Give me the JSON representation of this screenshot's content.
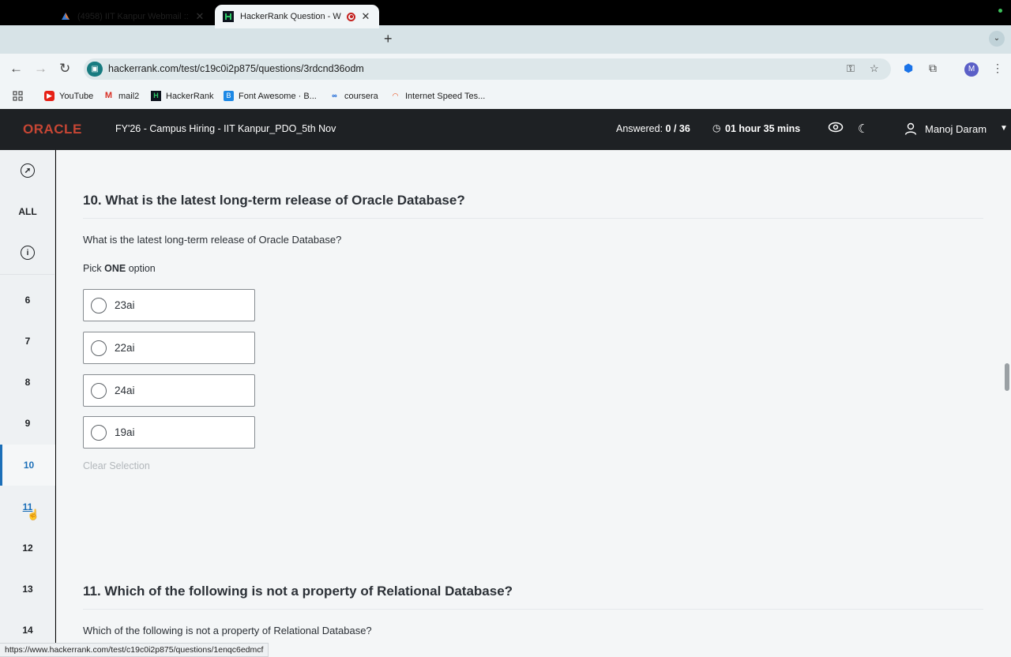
{
  "browser": {
    "tabs": [
      {
        "title": "(4958) IIT Kanpur Webmail ::",
        "favicon": "webmail-logo-icon",
        "active": false
      },
      {
        "title": "HackerRank Question - W",
        "favicon": "hackerrank-logo-icon",
        "active": true
      }
    ],
    "url": "hackerrank.com/test/c19c0i2p875/questions/3rdcnd36odm",
    "bookmarks": [
      {
        "label": "YouTube",
        "icon": "youtube-icon"
      },
      {
        "label": "mail2",
        "icon": "gmail-icon"
      },
      {
        "label": "HackerRank",
        "icon": "hackerrank-icon"
      },
      {
        "label": "Font Awesome · B...",
        "icon": "font-awesome-icon"
      },
      {
        "label": "coursera",
        "icon": "coursera-icon"
      },
      {
        "label": "Internet Speed Tes...",
        "icon": "speedometer-icon"
      }
    ],
    "profile_initial": "M",
    "status_url": "https://www.hackerrank.com/test/c19c0i2p875/questions/1enqc6edmcf"
  },
  "header": {
    "logo": "ORACLE",
    "test_title": "FY'26 - Campus Hiring - IIT Kanpur_PDO_5th Nov",
    "answered_label": "Answered:",
    "answered_value": "0 / 36",
    "timer": "01 hour 35 mins",
    "user_name": "Manoj Daram"
  },
  "sidebar": {
    "all_label": "ALL",
    "items": [
      "6",
      "7",
      "8",
      "9",
      "10",
      "11",
      "12",
      "13",
      "14"
    ],
    "active": "10",
    "hover": "11"
  },
  "question10": {
    "heading": "10. What is the latest long-term release of Oracle Database?",
    "text": "What is the latest long-term release of Oracle Database?",
    "pick_prefix": "Pick",
    "pick_bold": "ONE",
    "pick_suffix": "option",
    "options": [
      "23ai",
      "22ai",
      "24ai",
      "19ai"
    ],
    "clear_label": "Clear Selection"
  },
  "question11": {
    "heading": "11. Which of the following is not a property of Relational Database?",
    "text": "Which of the following is not a property of Relational Database?"
  },
  "colors": {
    "oracle_red": "#c74634",
    "header_bg": "#1e2124",
    "active_blue": "#1c6fb8"
  }
}
